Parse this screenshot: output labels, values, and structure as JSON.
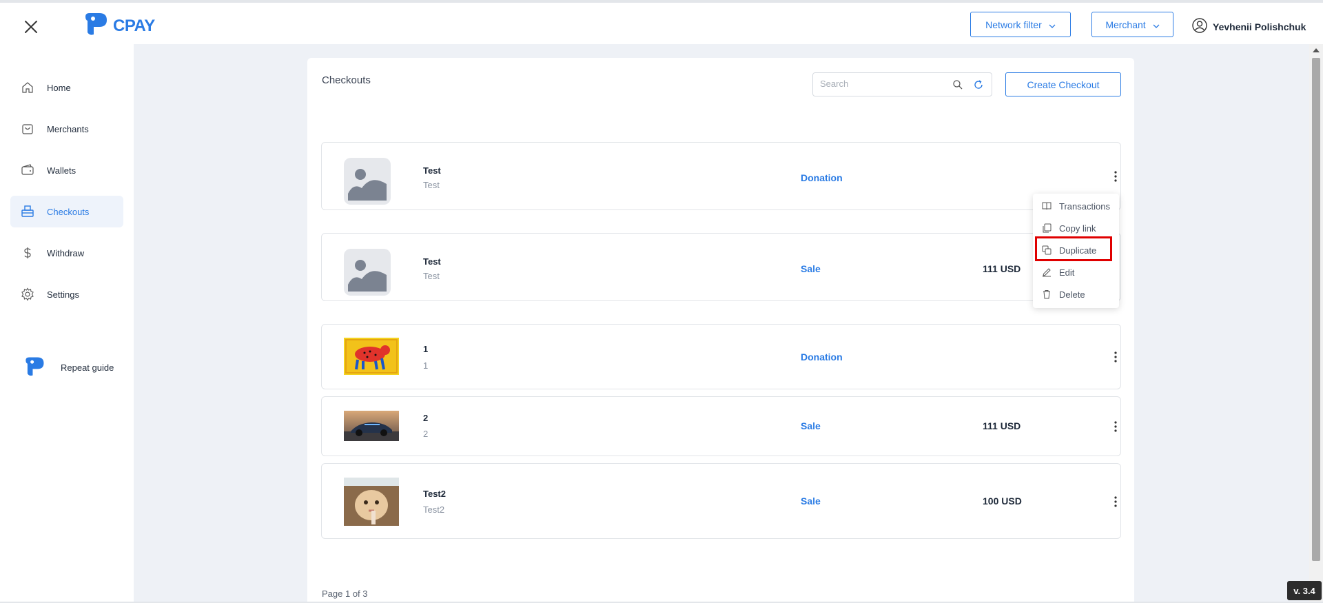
{
  "topbar": {
    "logo_text": "CPAY",
    "network_filter": "Network filter",
    "merchant": "Merchant",
    "user_name": "Yevhenii Polishchuk"
  },
  "sidebar": {
    "items": [
      {
        "label": "Home",
        "icon": "home-icon"
      },
      {
        "label": "Merchants",
        "icon": "bag-icon"
      },
      {
        "label": "Wallets",
        "icon": "wallet-icon"
      },
      {
        "label": "Checkouts",
        "icon": "checkout-icon",
        "active": true
      },
      {
        "label": "Withdraw",
        "icon": "dollar-icon"
      },
      {
        "label": "Settings",
        "icon": "gear-icon"
      }
    ],
    "repeat_guide": "Repeat guide"
  },
  "checkouts": {
    "title": "Checkouts",
    "search_placeholder": "Search",
    "create_label": "Create Checkout",
    "rows": [
      {
        "name": "Test",
        "description": "Test",
        "type": "Donation",
        "price": ""
      },
      {
        "name": "Test",
        "description": "Test",
        "type": "Sale",
        "price": "111 USD"
      },
      {
        "name": "1",
        "description": "1",
        "type": "Donation",
        "price": ""
      },
      {
        "name": "2",
        "description": "2",
        "type": "Sale",
        "price": "111 USD"
      },
      {
        "name": "Test2",
        "description": "Test2",
        "type": "Sale",
        "price": "100 USD"
      }
    ],
    "pagination": "Page 1 of 3"
  },
  "context_menu": {
    "items": [
      "Transactions",
      "Copy link",
      "Duplicate",
      "Edit",
      "Delete"
    ],
    "highlighted": "Duplicate"
  },
  "version": "v. 3.4",
  "colors": {
    "accent": "#2a7be4",
    "highlight": "#e00000",
    "background": "#eef1f6"
  }
}
